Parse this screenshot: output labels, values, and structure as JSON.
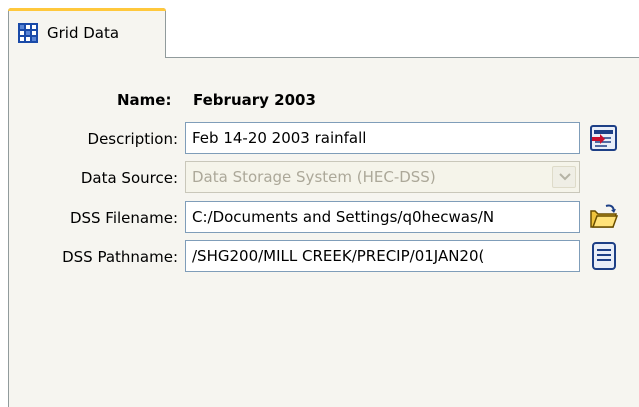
{
  "tab": {
    "label": "Grid Data",
    "icon": "grid-icon"
  },
  "form": {
    "name_label": "Name:",
    "name_value": "February 2003",
    "description_label": "Description:",
    "description_value": "Feb 14-20 2003 rainfall",
    "data_source_label": "Data Source:",
    "data_source_value": "Data Storage System (HEC-DSS)",
    "dss_filename_label": "DSS Filename:",
    "dss_filename_value": "C:/Documents and Settings/q0hecwas/N",
    "dss_pathname_label": "DSS Pathname:",
    "dss_pathname_value": "/SHG200/MILL CREEK/PRECIP/01JAN20("
  },
  "icons": {
    "description_button": "edit-description-icon",
    "filename_button": "open-folder-icon",
    "pathname_button": "select-pathname-icon"
  },
  "colors": {
    "tab_accent": "#ffc83c",
    "panel_background": "#f6f5f0",
    "field_border": "#7f9db9",
    "disabled_text": "#aca899"
  }
}
